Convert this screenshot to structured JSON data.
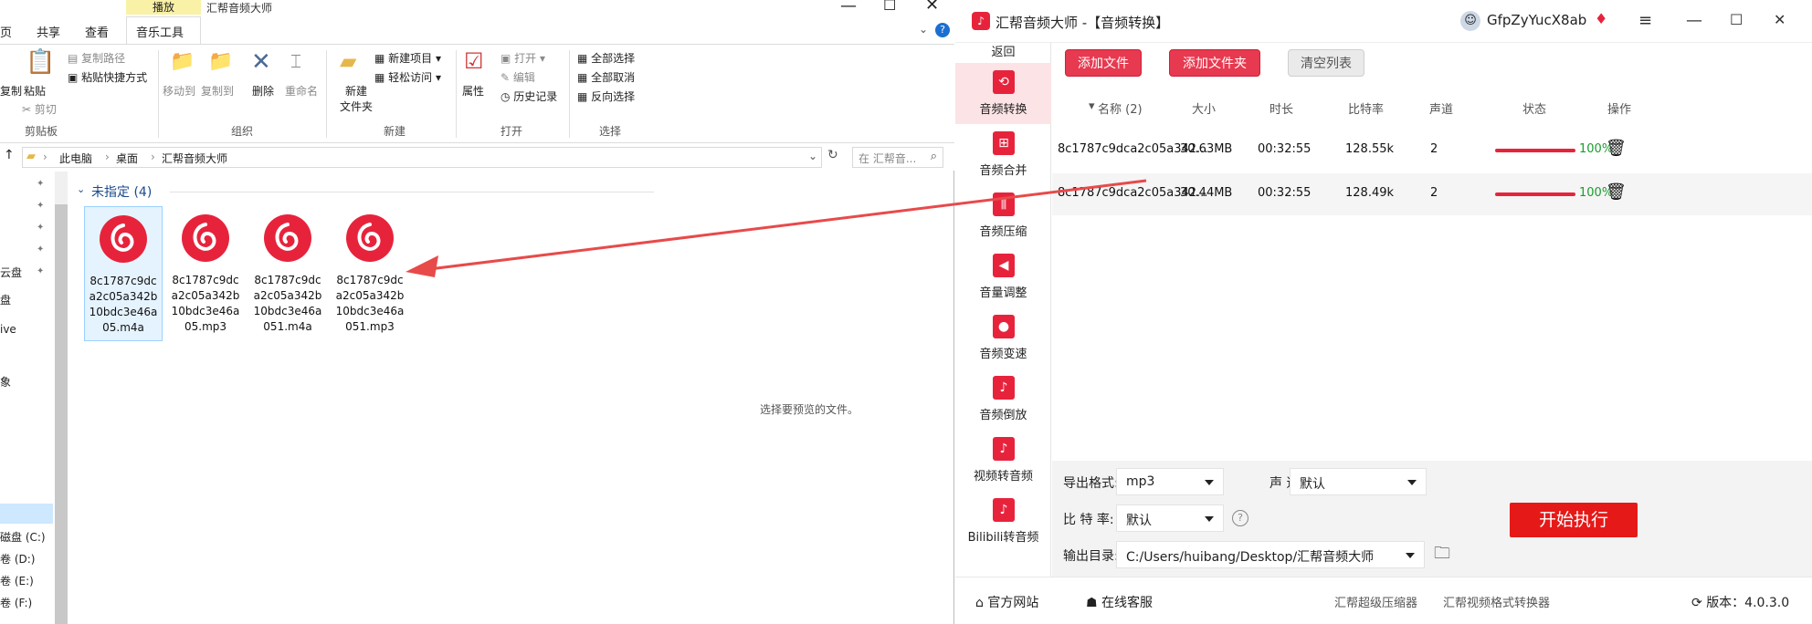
{
  "explorer": {
    "context_tab_top": "播放",
    "window_title": "汇帮音频大师",
    "tabs": [
      "页",
      "共享",
      "查看",
      "音乐工具"
    ],
    "ribbon": {
      "clipboard": {
        "copy": "复制",
        "paste": "粘贴",
        "copy_path": "复制路径",
        "paste_shortcut": "粘贴快捷方式",
        "cut": "剪切",
        "group": "剪贴板"
      },
      "organize": {
        "move_to": "移动到",
        "copy_to": "复制到",
        "delete": "删除",
        "rename": "重命名",
        "group": "组织"
      },
      "new": {
        "new_folder_line1": "新建",
        "new_folder_line2": "文件夹",
        "new_item": "新建项目",
        "easy_access": "轻松访问",
        "group": "新建"
      },
      "open": {
        "properties": "属性",
        "open": "打开",
        "edit": "编辑",
        "history": "历史记录",
        "group": "打开"
      },
      "select": {
        "select_all": "全部选择",
        "select_none": "全部取消",
        "invert": "反向选择",
        "group": "选择"
      }
    },
    "breadcrumb": [
      "此电脑",
      "桌面",
      "汇帮音频大师"
    ],
    "search_placeholder": "在 汇帮音...",
    "nav": {
      "cloud": "云盘",
      "disk": "盘",
      "drive": "ive",
      "objects": "象",
      "drive_c": "磁盘 (C:)",
      "drive_d": "卷 (D:)",
      "drive_e": "卷 (E:)",
      "drive_f": "卷 (F:)"
    },
    "group_header": "未指定 (4)",
    "files": [
      {
        "name": "8c1787c9dca2c05a342b10bdc3e46a05.m4a",
        "lines": [
          "8c1787c9dc",
          "a2c05a342b",
          "10bdc3e46a",
          "05.m4a"
        ]
      },
      {
        "name": "8c1787c9dca2c05a342b10bdc3e46a05.mp3",
        "lines": [
          "8c1787c9dc",
          "a2c05a342b",
          "10bdc3e46a",
          "05.mp3"
        ]
      },
      {
        "name": "8c1787c9dca2c05a342b10bdc3e46a051.m4a",
        "lines": [
          "8c1787c9dc",
          "a2c05a342b",
          "10bdc3e46a",
          "051.m4a"
        ]
      },
      {
        "name": "8c1787c9dca2c05a342b10bdc3e46a051.mp3",
        "lines": [
          "8c1787c9dc",
          "a2c05a342b",
          "10bdc3e46a",
          "051.mp3"
        ]
      }
    ],
    "preview_text": "选择要预览的文件。"
  },
  "app": {
    "title": "汇帮音频大师 -【音频转换】",
    "username": "GfpZyYucX8ab",
    "back": "返回",
    "sidebar": [
      "音频转换",
      "音频合并",
      "音频压缩",
      "音量调整",
      "音频变速",
      "音频倒放",
      "视频转音频",
      "Bilibili转音频"
    ],
    "buttons": {
      "add_file": "添加文件",
      "add_folder": "添加文件夹",
      "clear_list": "清空列表"
    },
    "columns": {
      "name": "名称 (2)",
      "size": "大小",
      "duration": "时长",
      "bitrate": "比特率",
      "channels": "声道",
      "status": "状态",
      "action": "操作"
    },
    "rows": [
      {
        "name": "8c1787c9dca2c05a342...",
        "size": "30.63MB",
        "duration": "00:32:55",
        "bitrate": "128.55k",
        "channels": "2",
        "progress": 1.0,
        "status": "100%"
      },
      {
        "name": "8c1787c9dca2c05a342...",
        "size": "30.44MB",
        "duration": "00:32:55",
        "bitrate": "128.49k",
        "channels": "2",
        "progress": 1.0,
        "status": "100%"
      }
    ],
    "settings": {
      "format_label": "导出格式:",
      "format_value": "mp3",
      "channel_label": "声 道:",
      "channel_value": "默认",
      "bitrate_label": "比 特 率:",
      "bitrate_value": "默认",
      "output_label": "输出目录:",
      "output_value": "C:/Users/huibang/Desktop/汇帮音频大师",
      "start": "开始执行"
    },
    "footer": {
      "website": "官方网站",
      "support": "在线客服",
      "link1": "汇帮超级压缩器",
      "link2": "汇帮视频格式转换器",
      "version": "版本：4.0.3.0"
    }
  },
  "colors": {
    "accent": "#e7233c",
    "status_green": "#1a9c2e",
    "arrow": "#e84a4a"
  }
}
